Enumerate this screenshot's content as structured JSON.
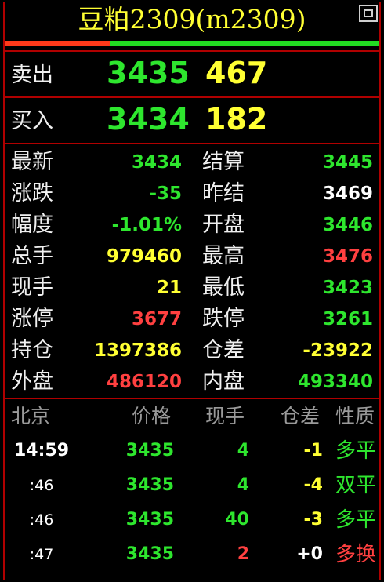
{
  "title": "豆粕2309(m2309)",
  "quote": {
    "sell_label": "卖出",
    "sell_price": "3435",
    "sell_volume": "467",
    "buy_label": "买入",
    "buy_price": "3434",
    "buy_volume": "182"
  },
  "stats": {
    "left": [
      {
        "label": "最新",
        "value": "3434"
      },
      {
        "label": "涨跌",
        "value": "-35"
      },
      {
        "label": "幅度",
        "value": "-1.01%"
      },
      {
        "label": "总手",
        "value": "979460"
      },
      {
        "label": "现手",
        "value": "21"
      },
      {
        "label": "涨停",
        "value": "3677"
      },
      {
        "label": "持仓",
        "value": "1397386"
      },
      {
        "label": "外盘",
        "value": "486120"
      }
    ],
    "right": [
      {
        "label": "结算",
        "value": "3445"
      },
      {
        "label": "昨结",
        "value": "3469"
      },
      {
        "label": "开盘",
        "value": "3446"
      },
      {
        "label": "最高",
        "value": "3476"
      },
      {
        "label": "最低",
        "value": "3423"
      },
      {
        "label": "跌停",
        "value": "3261"
      },
      {
        "label": "仓差",
        "value": "-23922"
      },
      {
        "label": "内盘",
        "value": "493340"
      }
    ]
  },
  "ticks": {
    "headers": [
      "北京",
      "价格",
      "现手",
      "仓差",
      "性质"
    ],
    "rows": [
      {
        "time": "14:59",
        "price": "3435",
        "volume": "4",
        "oi_change": "-1",
        "nature": "多平"
      },
      {
        "time": ":46",
        "price": "3435",
        "volume": "4",
        "oi_change": "-4",
        "nature": "双平"
      },
      {
        "time": ":46",
        "price": "3435",
        "volume": "40",
        "oi_change": "-3",
        "nature": "多平"
      },
      {
        "time": ":47",
        "price": "3435",
        "volume": "2",
        "oi_change": "+0",
        "nature": "多换"
      }
    ]
  },
  "colors": {
    "up": "#ff4040",
    "down": "#2ee62e",
    "neutral": "#ffff33",
    "border": "#b00000"
  },
  "window_icon": "restore-window-icon"
}
